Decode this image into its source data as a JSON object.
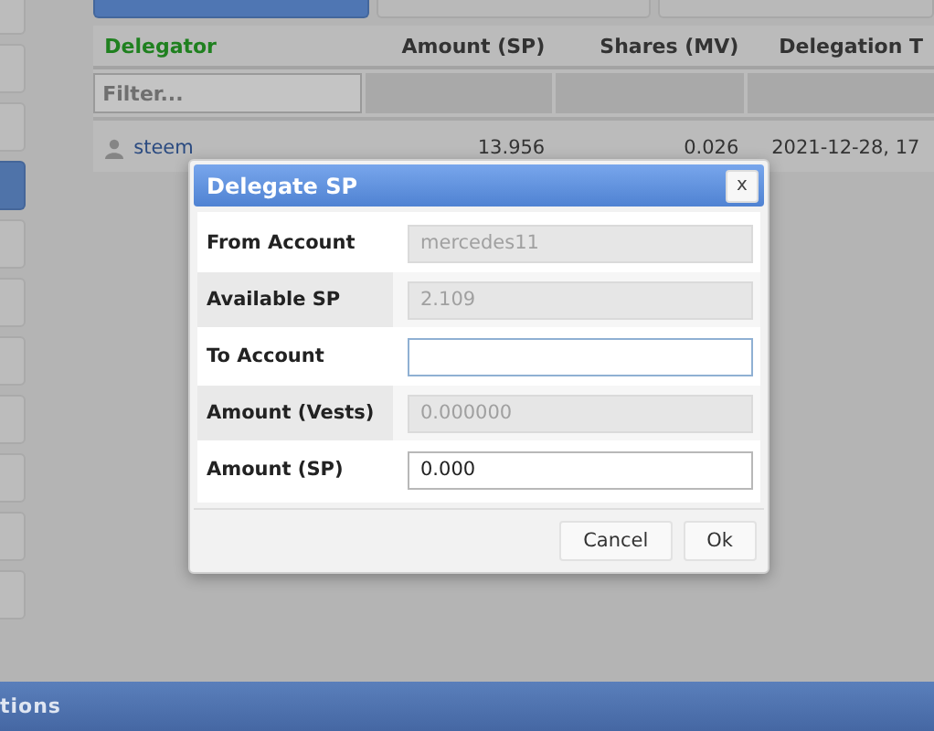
{
  "sidebar": {
    "items": [
      {
        "selected": false
      },
      {
        "selected": false
      },
      {
        "selected": false
      },
      {
        "selected": true
      },
      {
        "selected": false
      },
      {
        "selected": false
      },
      {
        "selected": false
      },
      {
        "selected": false
      },
      {
        "selected": false
      },
      {
        "selected": false
      },
      {
        "selected": false
      }
    ]
  },
  "tabs": [
    {
      "selected": true
    },
    {
      "selected": false
    },
    {
      "selected": false
    }
  ],
  "table": {
    "columns": [
      "Delegator",
      "Amount (SP)",
      "Shares (MV)",
      "Delegation T"
    ],
    "filter": {
      "placeholder": "Filter..."
    },
    "rows": [
      {
        "cells": [
          "steem",
          "13.956",
          "0.026",
          "2021-12-28, 17"
        ]
      }
    ]
  },
  "dialog": {
    "title": "Delegate SP",
    "close": "x",
    "fields": [
      {
        "label": "From Account",
        "value": "mercedes11",
        "disabled": true,
        "focused": false
      },
      {
        "label": "Available SP",
        "value": "2.109",
        "disabled": true,
        "focused": false
      },
      {
        "label": "To Account",
        "disabled": false,
        "focused": true
      },
      {
        "label": "Amount (Vests)",
        "value": "0.000000",
        "disabled": true,
        "focused": false
      },
      {
        "label": "Amount (SP)",
        "value": "0.000",
        "disabled": false,
        "focused": false
      }
    ],
    "buttons": [
      "Cancel",
      "Ok"
    ]
  },
  "bottom_bar": {
    "title": "tions"
  }
}
